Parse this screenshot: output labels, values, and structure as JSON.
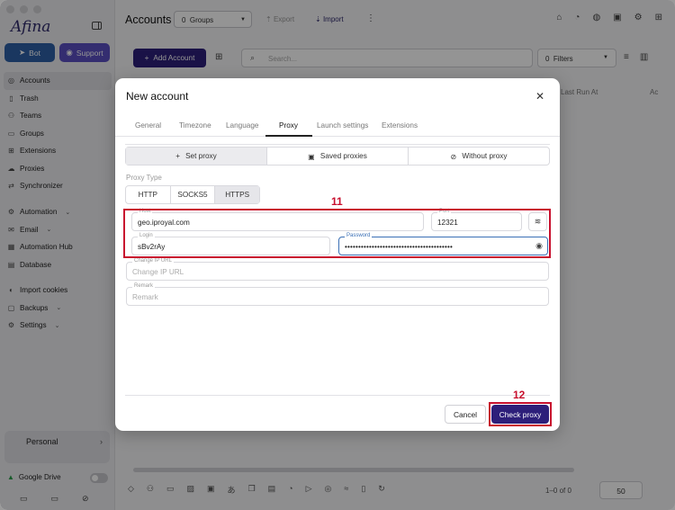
{
  "sidebar": {
    "logo": "Afina",
    "bot_label": "Bot",
    "support_label": "Support",
    "items": [
      {
        "label": "Accounts",
        "icon": "accounts-icon"
      },
      {
        "label": "Trash",
        "icon": "trash-icon"
      },
      {
        "label": "Teams",
        "icon": "teams-icon"
      },
      {
        "label": "Groups",
        "icon": "groups-icon"
      },
      {
        "label": "Extensions",
        "icon": "extensions-icon"
      },
      {
        "label": "Proxies",
        "icon": "proxies-icon"
      },
      {
        "label": "Synchronizer",
        "icon": "synchronizer-icon"
      },
      {
        "label": "Automation",
        "icon": "automation-icon"
      },
      {
        "label": "Email",
        "icon": "email-icon"
      },
      {
        "label": "Automation Hub",
        "icon": "automation-hub-icon"
      },
      {
        "label": "Database",
        "icon": "database-icon"
      },
      {
        "label": "Import cookies",
        "icon": "import-cookies-icon"
      },
      {
        "label": "Backups",
        "icon": "backups-icon"
      },
      {
        "label": "Settings",
        "icon": "settings-icon"
      }
    ],
    "workspace": "Personal",
    "google_drive": "Google Drive"
  },
  "main": {
    "title": "Accounts",
    "groups_count": "0",
    "groups_label": "Groups",
    "export_label": "Export",
    "import_label": "Import",
    "add_account_label": "Add Account",
    "search_placeholder": "Search...",
    "filters_count": "0",
    "filters_label": "Filters",
    "col_last_run": "Last Run At",
    "col_next": "Ac",
    "pager_text": "1–0 of 0",
    "per_page": "50"
  },
  "modal": {
    "title": "New account",
    "tabs": [
      "General",
      "Timezone",
      "Language",
      "Proxy",
      "Launch settings",
      "Extensions"
    ],
    "active_tab": "Proxy",
    "segments": [
      "Set proxy",
      "Saved proxies",
      "Without proxy"
    ],
    "proxy_type_label": "Proxy Type",
    "proxy_types": [
      "HTTP",
      "SOCKS5",
      "HTTPS"
    ],
    "selected_proxy_type": "HTTPS",
    "host_label": "Host",
    "host_value": "geo.iproyal.com",
    "port_label": "Port",
    "port_value": "12321",
    "login_label": "Login",
    "login_value": "sBv2rAy",
    "password_label": "Password",
    "password_value": "••••••••••••••••••••••••••••••••••••••••",
    "change_ip_label": "Change IP URL",
    "change_ip_placeholder": "Change IP URL",
    "remark_label": "Remark",
    "remark_placeholder": "Remark",
    "cancel_label": "Cancel",
    "check_proxy_label": "Check proxy"
  },
  "annotations": {
    "fields_step": "11",
    "check_step": "12",
    "color": "#c8102e"
  },
  "colors": {
    "primary": "#2d1f7a",
    "bot": "#2d5fa6",
    "support": "#5a4ec2"
  }
}
